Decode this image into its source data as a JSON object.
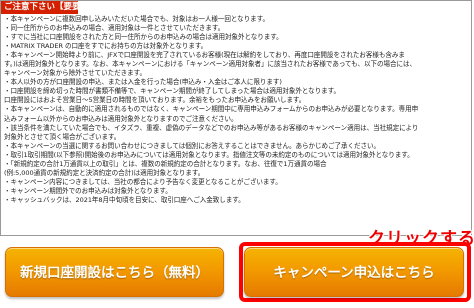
{
  "notice": {
    "header": "ご注意下さい【要要】",
    "lines": [
      "・本キャンペーンに複数回申し込みいただいた場合でも、対象はお一人様一回となります。",
      "・同一住所からのお申込みの場合、適用対象は一件とさせていただきます。",
      "・すでに当社に口座開設をされた方と同一住所からのお申込みの場合は適用対象外となります。",
      "・MATRIX TRADER の口座をすでにお持ちの方は対象外となります。",
      "・本キャンペーン開始時より前に、JFXで口座開設を完了されているお客様(現在は解約をしており、再度口座開設をされたお客様も含みま",
      "す。)は適用対象外となります。なお、本キャンペーンにおける「キャンペーン適用対象者」に該当されたお客様であっても、以下の場合には、",
      "キャンペーン対象から除外させていただきます。",
      "・本人以外の方が口座開設の申込、または入金を行った場合(申込み・入金はご本人に限ります)",
      "・口座開設を締め切った時間が書類不備等で、キャンペーン期間が終了してしまった場合は適用対象外となります。",
      "口座開設にはおよそ営業日～5営業日の時間を頂いております。余裕をもったお申込みをお願いします。",
      "・本キャンペーンは、自動的に適用されるものではなく、キャンペーン期間中に専用申込みフォームからのお申込みが必要となります。専用申",
      "込みフォーム以外からのお申込みは適用対象外となりますのでご注意ください。",
      "・該当条件を満たしていた場合でも、イタズラ、重複、虚偽のデータなどでのお申込み等があるお客様のキャンペーン適用は、当社規定により",
      "対象外とさせて頂く場合がございます。",
      "・本キャンペーンの当選に関するお問い合わせにつきましては個別にお答えすることはできません。あらかじめご了承ください。",
      "・取引1取引期間(以下参照)開始後のお申込みについては適用対象となります。指値注文等の未約定のものについては適用対象外となります。",
      "・「新規約定の合計1万通貨以上の取引」とは、複数の新規約定の合計となります。なお、往復で1万通貨の場合",
      "(例:5,000通貨の新規約定と決済約定の合計)は適用対象となります。",
      "・キャンペーン内容につきましては、当社の都合により予告なく変更となることがございます。",
      "・キャンペーン期間外でのお申込みは対象外となります。",
      "・キャッシュバックは、2021年8月中旬頃を目安に、取引口座へご入金致します。"
    ]
  },
  "annotation": {
    "label": "クリックする",
    "arrow_icon": "down-arrow-icon",
    "color": "#ee0000"
  },
  "buttons": {
    "open_account": "新規口座開設はこちら（無料）",
    "apply_campaign": "キャンペーン申込はこちら"
  },
  "colors": {
    "button_gradient_top": "#f4b400",
    "button_gradient_bottom": "#e57a00",
    "header_bg": "#d52000",
    "highlight": "#ff0000"
  }
}
